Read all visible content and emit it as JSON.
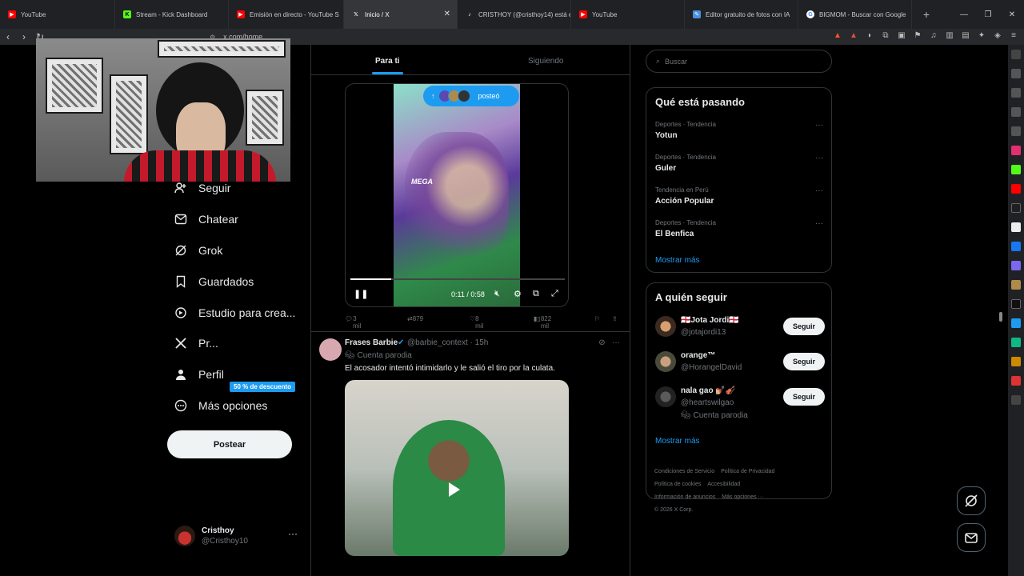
{
  "browser": {
    "tabs": [
      {
        "label": "YouTube",
        "icon": "youtube-icon",
        "color": "#ff0000"
      },
      {
        "label": "Stream - Kick Dashboard",
        "icon": "kick-icon",
        "color": "#53fc18"
      },
      {
        "label": "Emisión en directo - YouTube S",
        "icon": "youtube-icon",
        "color": "#ff0000"
      },
      {
        "label": "Inicio / X",
        "icon": "x-icon",
        "color": "#ffffff",
        "active": true
      },
      {
        "label": "CRISTHOY (@cristhoy14) está e",
        "icon": "tiktok-icon",
        "color": "#ffffff"
      },
      {
        "label": "YouTube",
        "icon": "youtube-icon",
        "color": "#ff0000"
      },
      {
        "label": "Editor gratuito de fotos con IA",
        "icon": "editor-icon",
        "color": "#4a90e2"
      },
      {
        "label": "BIGMOM - Buscar con Google",
        "icon": "google-icon",
        "color": "#4285f4"
      }
    ],
    "url": "x.com/home"
  },
  "nav": {
    "items": [
      {
        "label": "Seguir",
        "icon": "follow-icon"
      },
      {
        "label": "Chatear",
        "icon": "chat-icon"
      },
      {
        "label": "Grok",
        "icon": "grok-icon"
      },
      {
        "label": "Guardados",
        "icon": "bookmark-icon"
      },
      {
        "label": "Estudio para crea...",
        "icon": "studio-icon"
      },
      {
        "label": "Pr...",
        "icon": "x-premium-icon"
      },
      {
        "label": "Perfil",
        "icon": "profile-icon"
      },
      {
        "label": "Más opciones",
        "icon": "more-icon"
      }
    ],
    "promo": "50 % de descuento",
    "post_label": "Postear",
    "account": {
      "name": "Cristhoy",
      "handle": "@Cristhoy10"
    }
  },
  "timeline": {
    "tabs": [
      "Para ti",
      "Siguiendo"
    ],
    "video": {
      "repost_label": "posteó",
      "logo_text": "MEGA",
      "time": "0:11 / 0:58",
      "progress": 0.19
    },
    "actions": {
      "replies": "3 mil",
      "reposts": "879",
      "likes": "8 mil",
      "views": "822 mil"
    },
    "tweet": {
      "name": "Frases Barbie",
      "handle": "@barbie_context · 15h",
      "subtitle": "Cuenta parodia",
      "text": "El acosador intentó intimidarlo y le salió el tiro por la culata."
    }
  },
  "sidebar": {
    "search_placeholder": "Buscar",
    "trends_title": "Qué está pasando",
    "trends": [
      {
        "category": "Deportes · Tendencia",
        "title": "Yotun"
      },
      {
        "category": "Deportes · Tendencia",
        "title": "Guler"
      },
      {
        "category": "Tendencia en Perú",
        "title": "Acción Popular"
      },
      {
        "category": "Deportes · Tendencia",
        "title": "El Benfica"
      }
    ],
    "show_more": "Mostrar más",
    "follow_title": "A quién seguir",
    "follows": [
      {
        "name": "🏴󠁧󠁢󠁥󠁮󠁧󠁿Jota Jordi🏴󠁧󠁢󠁥󠁮󠁧󠁿",
        "handle": "@jotajordi13",
        "button": "Seguir",
        "verified": true
      },
      {
        "name": "orange™",
        "handle": "@HorangelDavid",
        "button": "Seguir"
      },
      {
        "name": "nala gao 💅🏼🎻",
        "handle": "@heartswilgao",
        "sub": "Cuenta parodia",
        "button": "Seguir"
      }
    ],
    "footer": [
      "Condiciones de Servicio",
      "Política de Privacidad",
      "Política de cookies",
      "Accesibilidad",
      "Información de anuncios",
      "Más opciones ···",
      "© 2026 X Corp."
    ]
  },
  "colors": {
    "accent": "#1d9bf0",
    "background": "#000000"
  }
}
